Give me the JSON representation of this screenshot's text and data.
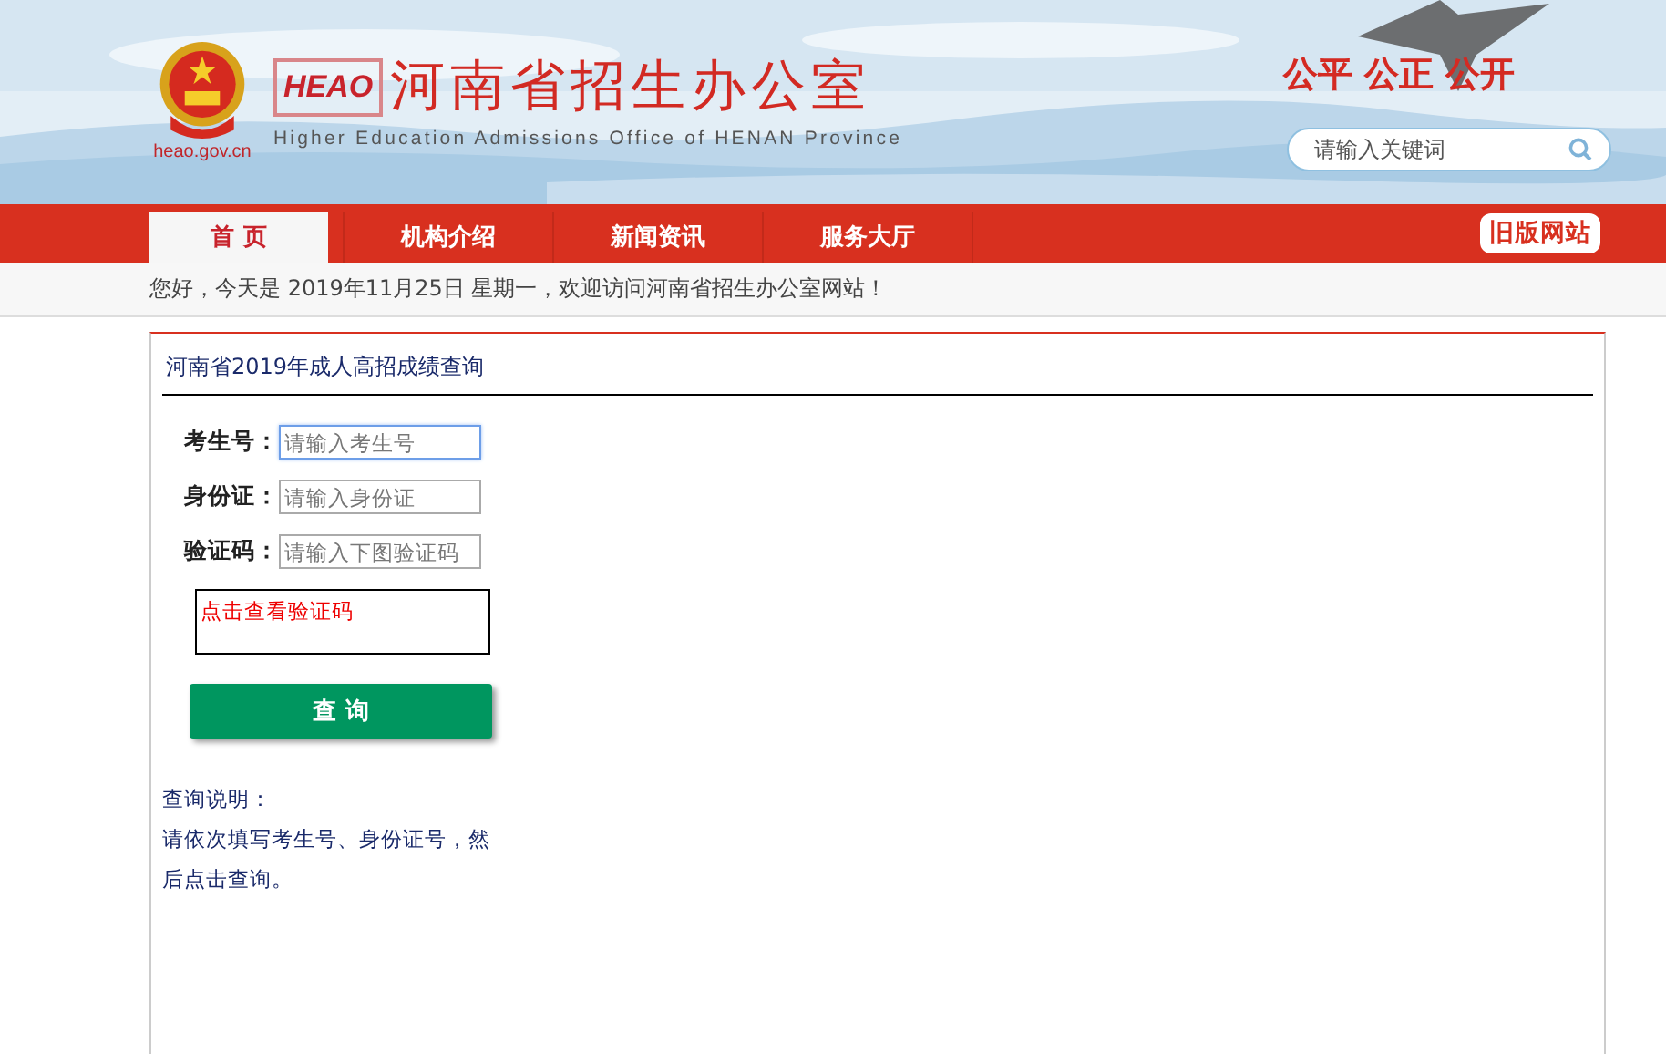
{
  "header": {
    "logo_badge": "HEAO",
    "site_title": "河南省招生办公室",
    "site_subtitle": "Higher Education Admissions Office of HENAN Province",
    "domain": "heao.gov.cn",
    "slogan": "公平 公正 公开",
    "search": {
      "placeholder": "请输入关键词"
    }
  },
  "nav": {
    "items": [
      {
        "label": "首 页",
        "selected": true
      },
      {
        "label": "机构介绍",
        "selected": false
      },
      {
        "label": "新闻资讯",
        "selected": false
      },
      {
        "label": "服务大厅",
        "selected": false
      }
    ],
    "old_site": "旧版网站"
  },
  "welcome": "您好，今天是 2019年11月25日 星期一，欢迎访问河南省招生办公室网站！",
  "panel": {
    "title": "河南省2019年成人高招成绩查询",
    "fields": [
      {
        "label": "考生号：",
        "placeholder": "请输入考生号",
        "focused": true
      },
      {
        "label": "身份证：",
        "placeholder": "请输入身份证",
        "focused": false
      },
      {
        "label": "验证码：",
        "placeholder": "请输入下图验证码",
        "focused": false
      }
    ],
    "captcha_link": "点击查看验证码",
    "submit": "查 询",
    "notes_title": "查询说明：",
    "notes": "请依次填写考生号、身份证号，然后点击查询。"
  }
}
